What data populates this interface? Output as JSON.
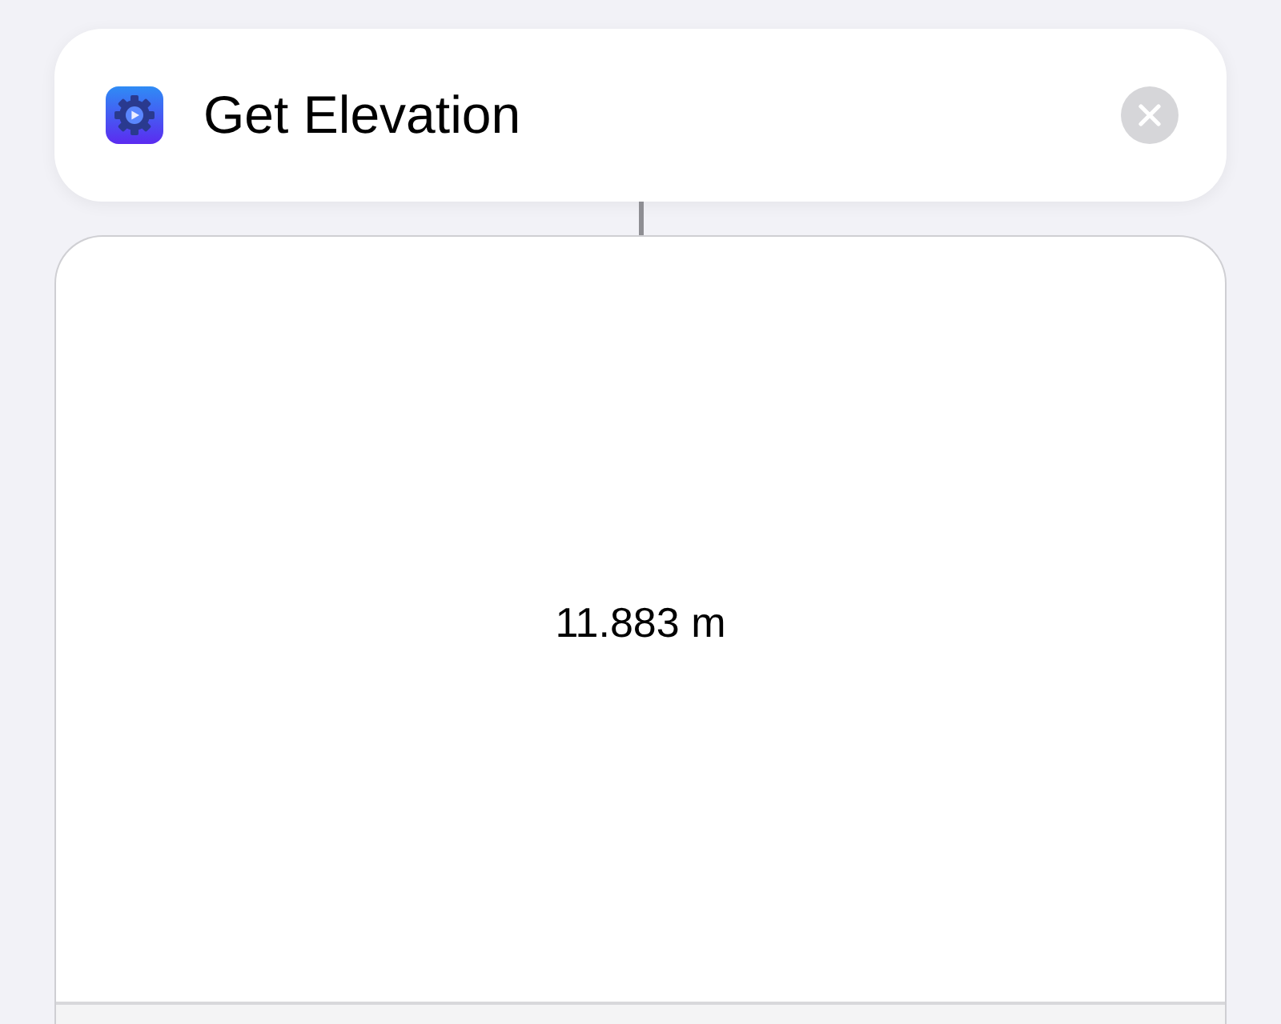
{
  "action": {
    "title": "Get Elevation"
  },
  "result": {
    "value": "11.883 m"
  }
}
